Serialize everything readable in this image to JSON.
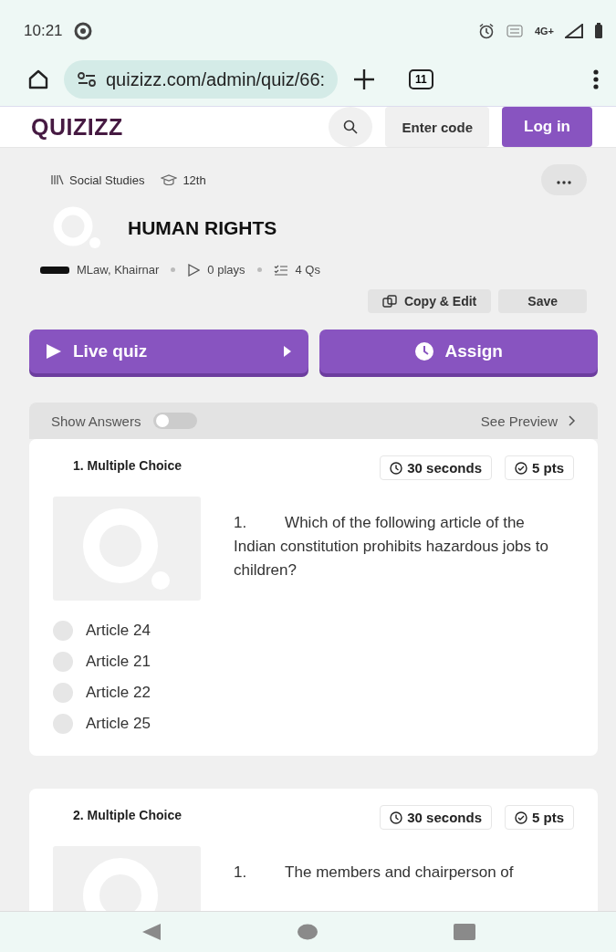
{
  "status_bar": {
    "time": "10:21",
    "network": "4G+"
  },
  "browser": {
    "url": "quizizz.com/admin/quiz/66:",
    "tab_count": "11"
  },
  "header": {
    "logo": "QUIZIZZ",
    "enter_code": "Enter code",
    "login": "Log in"
  },
  "quiz": {
    "subject": "Social Studies",
    "grade": "12th",
    "title": "HUMAN RIGHTS",
    "author": "MLaw, Khairnar",
    "plays": "0 plays",
    "questions": "4 Qs",
    "copy_edit": "Copy & Edit",
    "save": "Save",
    "live_quiz": "Live quiz",
    "assign": "Assign"
  },
  "answers_bar": {
    "label": "Show Answers",
    "on": false,
    "preview": "See Preview"
  },
  "questions": [
    {
      "heading": "1. Multiple Choice",
      "time": "30 seconds",
      "points": "5 pts",
      "text": "1.\tWhich of the following article of the Indian constitution prohibits hazardous jobs to children?",
      "options": [
        {
          "label": "Article 24",
          "selected": false
        },
        {
          "label": "Article 21",
          "selected": false
        },
        {
          "label": "Article 22",
          "selected": false
        },
        {
          "label": "Article 25",
          "selected": false
        }
      ]
    },
    {
      "heading": "2. Multiple Choice",
      "time": "30 seconds",
      "points": "5 pts",
      "text": "1.\tThe members and chairperson of"
    }
  ]
}
